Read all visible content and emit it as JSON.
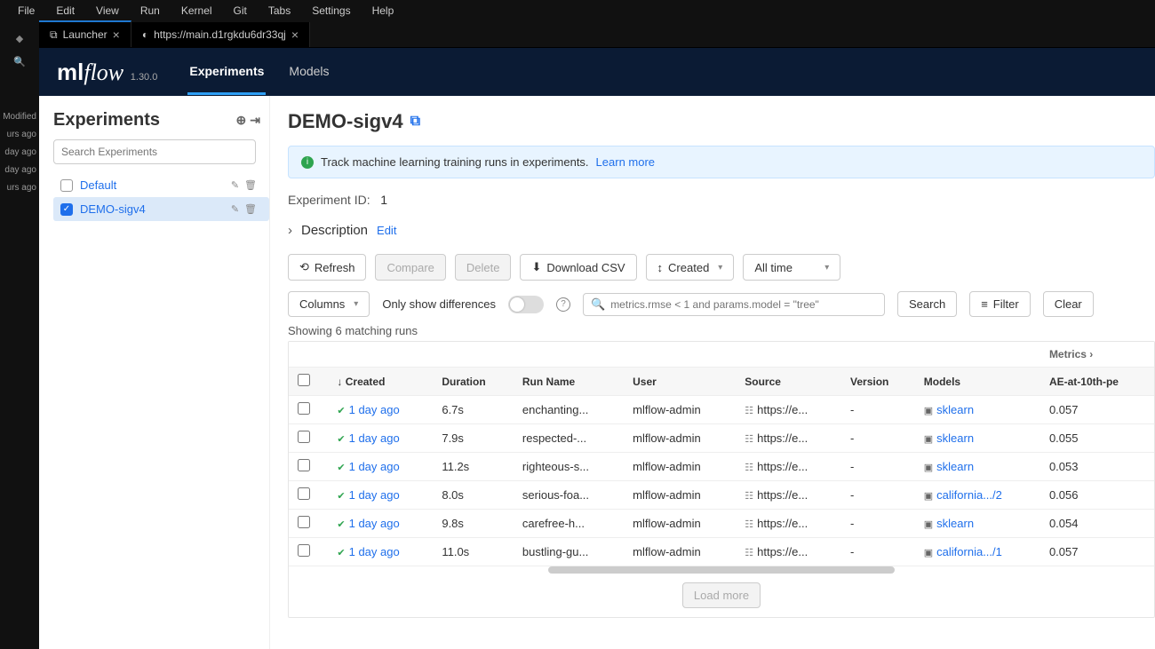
{
  "menubar": [
    "File",
    "Edit",
    "View",
    "Run",
    "Kernel",
    "Git",
    "Tabs",
    "Settings",
    "Help"
  ],
  "tabs": [
    {
      "icon": "⧉",
      "label": "Launcher",
      "active": true
    },
    {
      "icon": "◐",
      "label": "https://main.d1rgkdu6dr33qj",
      "active": false
    }
  ],
  "rail": {
    "modified": "Modified",
    "rows": [
      "urs ago",
      "day ago",
      "day ago",
      "urs ago"
    ]
  },
  "mlflow": {
    "brand_ml": "ml",
    "brand_flow": "flow",
    "version": "1.30.0",
    "nav": {
      "experiments": "Experiments",
      "models": "Models"
    }
  },
  "sidebar": {
    "title": "Experiments",
    "search_placeholder": "Search Experiments",
    "items": [
      {
        "label": "Default",
        "checked": false,
        "selected": false
      },
      {
        "label": "DEMO-sigv4",
        "checked": true,
        "selected": true
      }
    ]
  },
  "page": {
    "title": "DEMO-sigv4",
    "banner_text": "Track machine learning training runs in experiments.",
    "banner_link": "Learn more",
    "exp_id_label": "Experiment ID:",
    "exp_id_value": "1",
    "description_label": "Description",
    "edit_label": "Edit",
    "toolbar": {
      "refresh": "Refresh",
      "compare": "Compare",
      "delete": "Delete",
      "download": "Download CSV",
      "created": "Created",
      "alltime": "All time",
      "columns": "Columns",
      "only_diff": "Only show differences",
      "search_ph": "metrics.rmse < 1 and params.model = \"tree\"",
      "search": "Search",
      "filter": "Filter",
      "clear": "Clear"
    },
    "showing": "Showing 6 matching runs",
    "columns": {
      "created": "Created",
      "duration": "Duration",
      "run_name": "Run Name",
      "user": "User",
      "source": "Source",
      "version": "Version",
      "models": "Models",
      "metrics_group": "Metrics",
      "metric1": "AE-at-10th-pe"
    },
    "rows": [
      {
        "created": "1 day ago",
        "duration": "6.7s",
        "run": "enchanting...",
        "user": "mlflow-admin",
        "source": "https://e...",
        "version": "-",
        "model": "sklearn",
        "metric": "0.057"
      },
      {
        "created": "1 day ago",
        "duration": "7.9s",
        "run": "respected-...",
        "user": "mlflow-admin",
        "source": "https://e...",
        "version": "-",
        "model": "sklearn",
        "metric": "0.055"
      },
      {
        "created": "1 day ago",
        "duration": "11.2s",
        "run": "righteous-s...",
        "user": "mlflow-admin",
        "source": "https://e...",
        "version": "-",
        "model": "sklearn",
        "metric": "0.053"
      },
      {
        "created": "1 day ago",
        "duration": "8.0s",
        "run": "serious-foa...",
        "user": "mlflow-admin",
        "source": "https://e...",
        "version": "-",
        "model": "california.../2",
        "metric": "0.056"
      },
      {
        "created": "1 day ago",
        "duration": "9.8s",
        "run": "carefree-h...",
        "user": "mlflow-admin",
        "source": "https://e...",
        "version": "-",
        "model": "sklearn",
        "metric": "0.054"
      },
      {
        "created": "1 day ago",
        "duration": "11.0s",
        "run": "bustling-gu...",
        "user": "mlflow-admin",
        "source": "https://e...",
        "version": "-",
        "model": "california.../1",
        "metric": "0.057"
      }
    ],
    "load_more": "Load more"
  }
}
